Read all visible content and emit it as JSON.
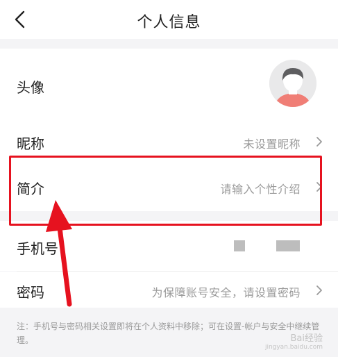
{
  "header": {
    "title": "个人信息",
    "back_icon": "chevron-left-icon"
  },
  "rows": {
    "avatar": {
      "label": "头像",
      "avatar_icon": "user-avatar"
    },
    "nickname": {
      "label": "昵称",
      "value": "未设置昵称"
    },
    "intro": {
      "label": "简介",
      "value": "请输入个性介绍"
    },
    "phone": {
      "label": "手机号",
      "value_masked": true
    },
    "password": {
      "label": "密码",
      "value": "为保障账号安全，请设置密码"
    }
  },
  "footnote": "注：手机号与密码相关设置即将在个人资料中移除；可在设置-帐户与安全中继续管理。",
  "watermark": {
    "text": "Bai经验",
    "sub": "jingyan.baidu.com"
  },
  "colors": {
    "highlight": "#e6121f",
    "arrow": "#e6121f",
    "avatar_skin": "#ffffff",
    "avatar_hair": "#5e5e60",
    "avatar_shirt": "#f07e76"
  }
}
